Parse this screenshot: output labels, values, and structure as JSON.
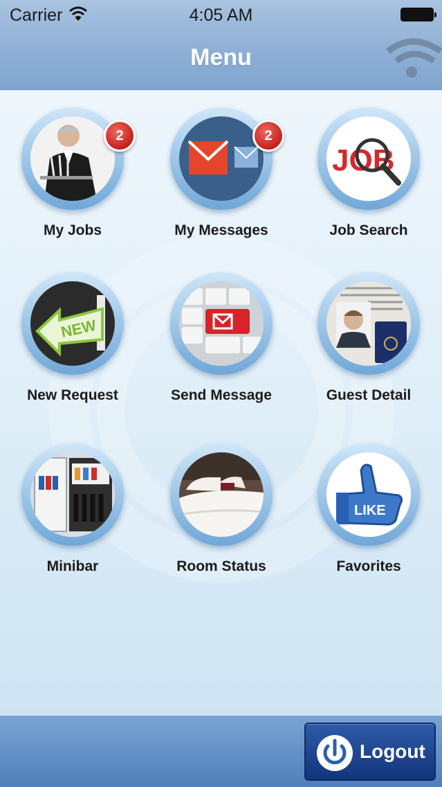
{
  "status_bar": {
    "carrier": "Carrier",
    "time": "4:05 AM"
  },
  "header": {
    "title": "Menu"
  },
  "menu": {
    "items": [
      {
        "label": "My Jobs",
        "badge": "2",
        "icon": "waiter-icon"
      },
      {
        "label": "My Messages",
        "badge": "2",
        "icon": "envelope-icon"
      },
      {
        "label": "Job Search",
        "badge": null,
        "icon": "job-search-icon"
      },
      {
        "label": "New Request",
        "badge": null,
        "icon": "new-arrow-icon"
      },
      {
        "label": "Send Message",
        "badge": null,
        "icon": "keyboard-mail-icon"
      },
      {
        "label": "Guest Detail",
        "badge": null,
        "icon": "passport-icon"
      },
      {
        "label": "Minibar",
        "badge": null,
        "icon": "minibar-fridge-icon"
      },
      {
        "label": "Room Status",
        "badge": null,
        "icon": "bed-icon"
      },
      {
        "label": "Favorites",
        "badge": null,
        "icon": "like-thumb-icon"
      }
    ]
  },
  "footer": {
    "logout_label": "Logout"
  },
  "colors": {
    "header": "#8fb0d6",
    "badge": "#d0302a",
    "logout": "#1f4690"
  }
}
